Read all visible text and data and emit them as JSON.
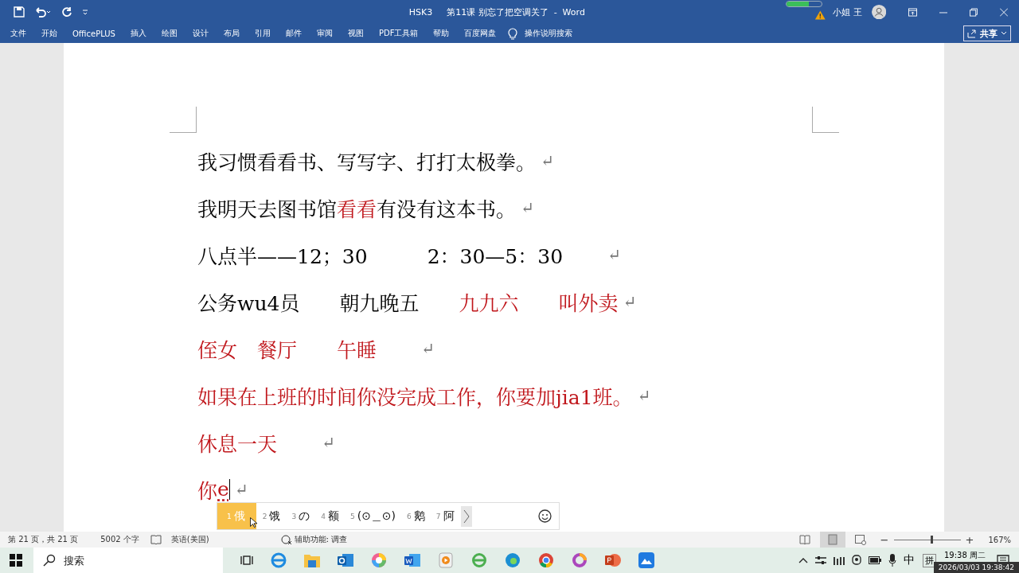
{
  "title_bar": {
    "doc_name": "HSK3",
    "title": "第11课 别忘了把空调关了  -  Word",
    "progress": {
      "level": 0.65
    },
    "user": "小姐 王"
  },
  "ribbon_tabs": [
    {
      "label": "文件",
      "selected": false
    },
    {
      "label": "开始",
      "selected": false
    },
    {
      "label": "OfficePLUS",
      "selected": false
    },
    {
      "label": "插入",
      "selected": false
    },
    {
      "label": "绘图",
      "selected": false
    },
    {
      "label": "设计",
      "selected": false
    },
    {
      "label": "布局",
      "selected": false
    },
    {
      "label": "引用",
      "selected": false
    },
    {
      "label": "邮件",
      "selected": false
    },
    {
      "label": "审阅",
      "selected": false
    },
    {
      "label": "视图",
      "selected": false
    },
    {
      "label": "PDF工具箱",
      "selected": false
    },
    {
      "label": "帮助",
      "selected": false
    },
    {
      "label": "百度网盘",
      "selected": false
    }
  ],
  "tell_me": "操作说明搜索",
  "share": "共享",
  "document": {
    "lines": [
      {
        "end_mark": "↵",
        "segments": [
          {
            "text": "我习惯看看书、写写字、打打太极拳。",
            "color": "#000000",
            "composing": false
          }
        ]
      },
      {
        "end_mark": "↵",
        "segments": [
          {
            "text": "我明天去图书馆",
            "color": "#000000",
            "composing": false
          },
          {
            "text": "看看",
            "color": "#c0161b",
            "composing": false
          },
          {
            "text": "有没有这本书。",
            "color": "#000000",
            "composing": false
          }
        ]
      },
      {
        "end_mark": "↵",
        "segments": [
          {
            "text": "八点半——12；30",
            "color": "#000000",
            "composing": false
          },
          {
            "text": "　　　2：30—5：30　　",
            "color": "#000000",
            "composing": false
          }
        ]
      },
      {
        "end_mark": "↵",
        "segments": [
          {
            "text": "公务wu4员",
            "color": "#000000",
            "composing": false
          },
          {
            "text": "　　朝九晚五",
            "color": "#000000",
            "composing": false
          },
          {
            "text": "　　九九六",
            "color": "#c0161b",
            "composing": false
          },
          {
            "text": "　　叫外卖",
            "color": "#c0161b",
            "composing": false
          }
        ]
      },
      {
        "end_mark": "↵",
        "segments": [
          {
            "text": "侄女",
            "color": "#c0161b",
            "composing": false
          },
          {
            "text": "　餐厅",
            "color": "#c0161b",
            "composing": false
          },
          {
            "text": "　　午睡　　",
            "color": "#c0161b",
            "composing": false
          }
        ]
      },
      {
        "end_mark": "↵",
        "segments": [
          {
            "text": "如果在上班的时间你没完成工作，你要加jia1班。",
            "color": "#c0161b",
            "composing": false
          }
        ]
      },
      {
        "end_mark": "↵",
        "segments": [
          {
            "text": "休息一天　　",
            "color": "#c0161b",
            "composing": false
          }
        ]
      },
      {
        "end_mark": "↵",
        "segments": [
          {
            "text": "你",
            "color": "#c0161b",
            "composing": false
          },
          {
            "text": "e",
            "color": "#c0161b",
            "composing": true
          }
        ]
      }
    ]
  },
  "ime": {
    "candidates": [
      {
        "index": "1",
        "text": "俄",
        "selected": true
      },
      {
        "index": "2",
        "text": "饿",
        "selected": false
      },
      {
        "index": "3",
        "text": "の",
        "selected": false
      },
      {
        "index": "4",
        "text": "额",
        "selected": false
      },
      {
        "index": "5",
        "text": "(⊙＿⊙)",
        "selected": false
      },
      {
        "index": "6",
        "text": "鹅",
        "selected": false
      },
      {
        "index": "7",
        "text": "阿",
        "selected": false
      }
    ]
  },
  "status_bar": {
    "page": "第 21 页，共 21 页",
    "words": "5002 个字",
    "language": "英语(美国)",
    "accessibility": "辅助功能: 调查",
    "zoom_out": "−",
    "zoom": {
      "level": 0.55
    },
    "zoom_in": "+",
    "zoom_percent": "167%"
  },
  "taskbar": {
    "search_placeholder": "搜索",
    "ime_mode": "中",
    "ime_layout": "拼",
    "clock": "19:38 周二",
    "tooltip": "2026/03/03 19:38:42"
  }
}
